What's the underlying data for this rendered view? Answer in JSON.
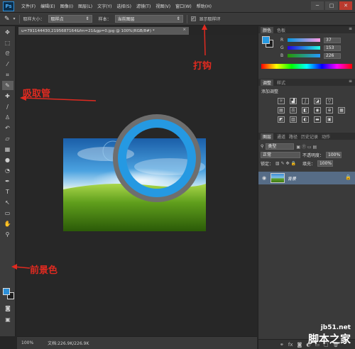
{
  "app": {
    "logo": "Ps"
  },
  "menu": {
    "items": [
      "文件(F)",
      "编辑(E)",
      "图像(I)",
      "图层(L)",
      "文字(Y)",
      "选择(S)",
      "滤镜(T)",
      "视图(V)",
      "窗口(W)",
      "帮助(H)"
    ]
  },
  "window_controls": {
    "minimize": "─",
    "maximize": "□",
    "close": "✕"
  },
  "options": {
    "sample_size_label": "取样大小：",
    "sample_size_value": "取样点",
    "sample_label": "样本：",
    "sample_value": "当前图层",
    "show_ring_check": "✓",
    "show_ring_label": "显示取样环"
  },
  "document": {
    "tab_title": "u=791144430,2195687164&fm=21&gp=0.jpg @ 100%(RGB/8#) *",
    "tab_close": "×"
  },
  "status": {
    "zoom": "100%",
    "doc_info": "文档:226.9K/226.9K"
  },
  "panels": {
    "color": {
      "tabs": [
        "颜色",
        "色板"
      ],
      "r_label": "R",
      "g_label": "G",
      "b_label": "B",
      "r": "37",
      "g": "153",
      "b": "226"
    },
    "adjustments": {
      "tabs": [
        "调整",
        "样式"
      ],
      "title": "添加调整"
    },
    "layers": {
      "tabs": [
        "图层",
        "通道",
        "路径",
        "历史记录",
        "动作"
      ],
      "kind_label": "类型",
      "blend_mode": "正常",
      "opacity_label": "不透明度：",
      "opacity": "100%",
      "lock_label": "锁定：",
      "fill_label": "填充：",
      "fill": "100%",
      "layer_name": "背景"
    }
  },
  "annotations": {
    "eyedropper": "吸取管",
    "checkbox": "打钩",
    "foreground": "前景色"
  },
  "watermark": {
    "url": "jb51.net",
    "name": "脚本之家"
  },
  "colors": {
    "foreground": "#2599E2",
    "annotation_red": "#E02A20",
    "ring_blue": "#2599E2",
    "ring_gray": "#6E6E6E"
  }
}
